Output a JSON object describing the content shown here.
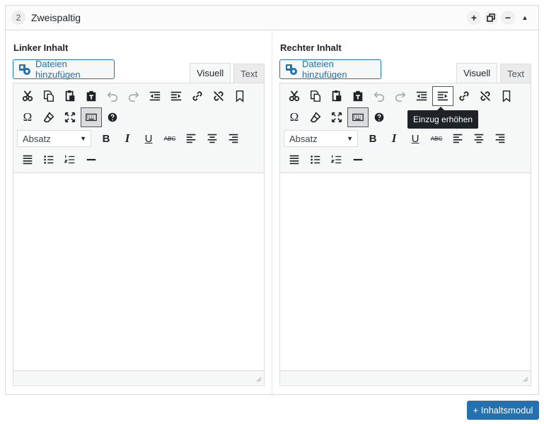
{
  "module": {
    "number": "2",
    "title": "Zweispaltig",
    "actions": {
      "add": "+",
      "minimize": "−",
      "toggle": "▲"
    }
  },
  "columns": [
    {
      "label": "Linker Inhalt",
      "media_button": "Dateien hinzufügen",
      "tabs": [
        "Visuell",
        "Text"
      ],
      "format_select": "Absatz",
      "tooltip": ""
    },
    {
      "label": "Rechter Inhalt",
      "media_button": "Dateien hinzufügen",
      "tabs": [
        "Visuell",
        "Text"
      ],
      "format_select": "Absatz",
      "tooltip": "Einzug erhöhen"
    }
  ],
  "toolbar_icons": {
    "row1": [
      "cut-icon",
      "copy-icon",
      "paste-icon",
      "paste-text-icon",
      "undo-icon",
      "redo-icon",
      "outdent-icon",
      "indent-icon",
      "link-icon",
      "unlink-icon",
      "bookmark-icon"
    ],
    "row2": [
      "special-char-icon",
      "eraser-icon",
      "fullscreen-icon",
      "keyboard-icon",
      "help-icon"
    ],
    "row3": [
      "bold-icon",
      "italic-icon",
      "underline-icon",
      "strikethrough-icon",
      "align-left-icon",
      "align-center-icon",
      "align-right-icon"
    ],
    "row4": [
      "justify-icon",
      "bullet-list-icon",
      "numbered-list-icon",
      "horizontal-rule-icon"
    ]
  },
  "format_letters": {
    "bold": "B",
    "italic": "I",
    "underline": "U",
    "strike": "ABC",
    "special": "Ω"
  },
  "footer": {
    "add_module": "+ Inhaltsmodul"
  },
  "colors": {
    "accent": "#2271b1",
    "tooltip_bg": "#1d2327",
    "toolbar_bg": "#f6f7f7"
  }
}
